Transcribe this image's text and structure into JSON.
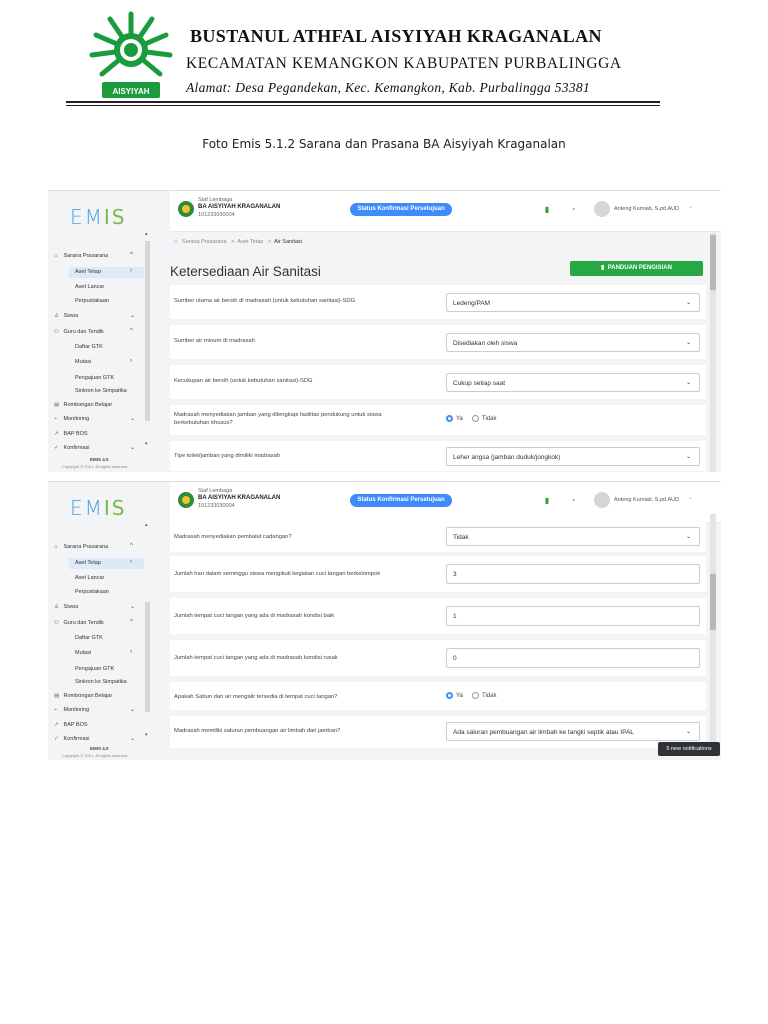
{
  "letterhead": {
    "school_name": "BUSTANUL ATHFAL AISYIYAH KRAGANALAN",
    "district": "KECAMATAN KEMANGKON KABUPATEN PURBALINGGA",
    "address": "Alamat: Desa Pegandekan, Kec. Kemangkon, Kab. Purbalingga 53381",
    "logo_text": "AISYIYAH",
    "logo_color": "#1a9c3c"
  },
  "caption": "Foto Emis 5.1.2 Sarana dan Prasana BA Aisyiyah Kraganalan",
  "app": {
    "logo_a": "EM",
    "logo_b": "IS",
    "staff_role": "Staf Lembaga",
    "school": "BA AISYIYAH KRAGANALAN",
    "npsn": "101233030004",
    "status_label": "Status Konfirmasi Persetujuan",
    "user": "Anteng Kurniati, S.pd.AUD",
    "accent": "#3d8bfd",
    "green": "#28a745"
  },
  "sidebar": {
    "items": {
      "sarana": "Sarana Prasarana",
      "aset_tetap": "Aset Tetap",
      "aset_lancar": "Aset Lancar",
      "perpustakaan": "Perpustakaan",
      "siswa": "Siswa",
      "gtk": "Guru dan Tendik",
      "daftar_gtk": "Daftar GTK",
      "mutasi": "Mutasi",
      "pengajuan": "Pengajuan GTK",
      "sinkron": "Sinkron ke Simpatika",
      "rombel": "Rombongan Belajar",
      "monitoring": "Monitoring",
      "bap": "BAP BOS",
      "konfirmasi": "Konfirmasi"
    },
    "footer_version": "EMIS 4.0",
    "footer_copyright": "Copyright © 2021. All rights reserved."
  },
  "screen1": {
    "breadcrumb": {
      "a": "Sarana Prasarana",
      "b": "Aset Tetap",
      "c": "Air Sanitasi"
    },
    "title": "Ketersediaan Air Sanitasi",
    "guide_button": "PANDUAN PENGISIAN",
    "rows": {
      "q1": "Sumber utama air bersih di madrasah (untuk kebutuhan sanitasi)-SDG",
      "a1": "Ledeng/PAM",
      "q2": "Sumber air minum di madrasah",
      "a2": "Disediakan oleh siswa",
      "q3": "Kecukupan air bersih (untuk kebutuhan sanitasi)-SDG",
      "a3": "Cukup setiap saat",
      "q4": "Madrasah menyediakan jamban yang dilengkapi fasilitas pendukung untuk siswa berkebutuhan khusus?",
      "yes": "Ya",
      "no": "Tidak",
      "q5": "Tipe toilet/jamban yang dimiliki madrasah",
      "a5": "Leher angsa (jamban duduk/jongkok)"
    }
  },
  "screen2": {
    "rows": {
      "q1": "Madrasah menyediakan pembalut cadangan?",
      "a1": "Tidak",
      "q2": "Jumlah hari dalam seminggu siswa mengikuti kegiatan cuci tangan berkelompok",
      "a2": "3",
      "q3": "Jumlah tempat cuci tangan yang ada di madrasah kondisi baik",
      "a3": "1",
      "q4": "Jumlah tempat cuci tangan yang ada di madrasah kondisi rusak",
      "a4": "0",
      "q5": "Apakah Sabun dan air mengalir tersedia di tempat cuci tangan?",
      "yes": "Ya",
      "no": "Tidak",
      "q6": "Madrasah memiliki saluran pembuangan air limbah dari jamban?",
      "a6": "Ada saluran pembuangan air limbah ke tangki septik atau IPAL"
    },
    "toast": "5 new notifications"
  }
}
